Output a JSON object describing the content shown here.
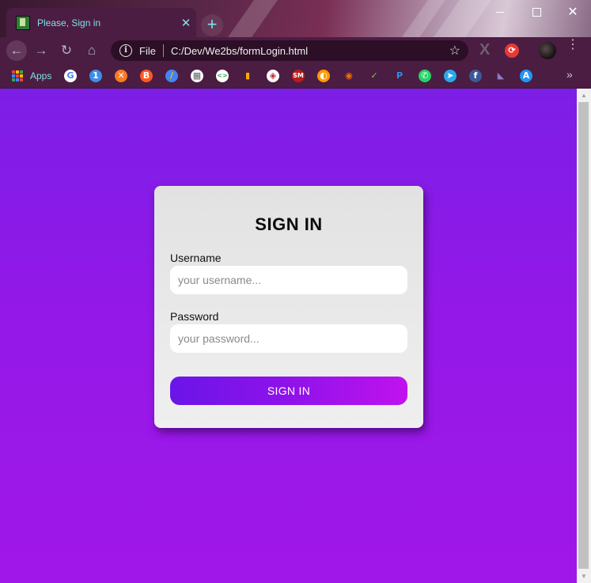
{
  "browser": {
    "tab": {
      "title": "Please, Sign in",
      "close_glyph": "✕"
    },
    "new_tab_glyph": "+",
    "window_controls": {
      "close_glyph": "✕"
    },
    "nav": {
      "back_glyph": "←",
      "forward_glyph": "→",
      "reload_glyph": "↻",
      "home_glyph": "⌂"
    },
    "address_bar": {
      "scheme_label": "File",
      "url": "C:/Dev/We2bs/formLogin.html",
      "info_glyph": "i",
      "star_glyph": "☆"
    },
    "extensions": {
      "x_glyph": "X",
      "red_glyph": "⟳"
    },
    "menu_glyph": "⋮",
    "bookmarks": {
      "apps_label": "Apps",
      "more_glyph": "»",
      "icons": [
        {
          "name": "google-icon",
          "glyph": "G",
          "color": "#4285f4",
          "bg": "#ffffff"
        },
        {
          "name": "bookmark-calendar-icon",
          "glyph": "1",
          "color": "#ffffff",
          "bg": "#3f8ee8"
        },
        {
          "name": "bookmark-xampp-icon",
          "glyph": "✕",
          "color": "#ffffff",
          "bg": "#fb7a24"
        },
        {
          "name": "blogger-icon",
          "glyph": "B",
          "color": "#ffffff",
          "bg": "#ff5722"
        },
        {
          "name": "google-ads-icon",
          "glyph": "/",
          "color": "#fbbc04",
          "bg": "#4285f4"
        },
        {
          "name": "bookmark-store-icon",
          "glyph": "▦",
          "color": "#5f6368",
          "bg": "#ffffff"
        },
        {
          "name": "bookmark-code-icon",
          "glyph": "<>",
          "color": "#34a853",
          "bg": "#ffffff"
        },
        {
          "name": "analytics-icon",
          "glyph": "▮",
          "color": "#f9ab00",
          "bg": "#4b1d42"
        },
        {
          "name": "bookmark-shield-icon",
          "glyph": "◈",
          "color": "#c62828",
          "bg": "#ffffff"
        },
        {
          "name": "bookmark-sm-icon",
          "glyph": "SM",
          "color": "#ffffff",
          "bg": "#b71c1c"
        },
        {
          "name": "bookmark-orange-icon",
          "glyph": "◐",
          "color": "#ffffff",
          "bg": "#ff9800"
        },
        {
          "name": "bookmark-circle-icon",
          "glyph": "◉",
          "color": "#ff6f00",
          "bg": "#4b1d42"
        },
        {
          "name": "bookmark-green-icon",
          "glyph": "✓",
          "color": "#8bc34a",
          "bg": "#4b1d42"
        },
        {
          "name": "paypal-icon",
          "glyph": "P",
          "color": "#2196f3",
          "bg": "#4b1d42"
        },
        {
          "name": "whatsapp-icon",
          "glyph": "✆",
          "color": "#ffffff",
          "bg": "#25d366"
        },
        {
          "name": "telegram-icon",
          "glyph": "➤",
          "color": "#ffffff",
          "bg": "#29a9eb"
        },
        {
          "name": "facebook-icon",
          "glyph": "f",
          "color": "#ffffff",
          "bg": "#3b5998"
        },
        {
          "name": "bookmark-feather-icon",
          "glyph": "◣",
          "color": "#8e7cc3",
          "bg": "#4b1d42"
        },
        {
          "name": "bookmark-blue-a-icon",
          "glyph": "A",
          "color": "#ffffff",
          "bg": "#2196f3"
        }
      ]
    }
  },
  "form": {
    "title": "SIGN IN",
    "username": {
      "label": "Username",
      "placeholder": "your username..."
    },
    "password": {
      "label": "Password",
      "placeholder": "your password..."
    },
    "submit_label": "SIGN IN"
  },
  "colors": {
    "page_gradient_top": "#7c1ee6",
    "page_gradient_bottom": "#a017e9",
    "button_gradient_start": "#6a15e8",
    "button_gradient_end": "#c012ee",
    "card_bg": "#e8e8e8",
    "tab_text": "#7fe0e6"
  }
}
